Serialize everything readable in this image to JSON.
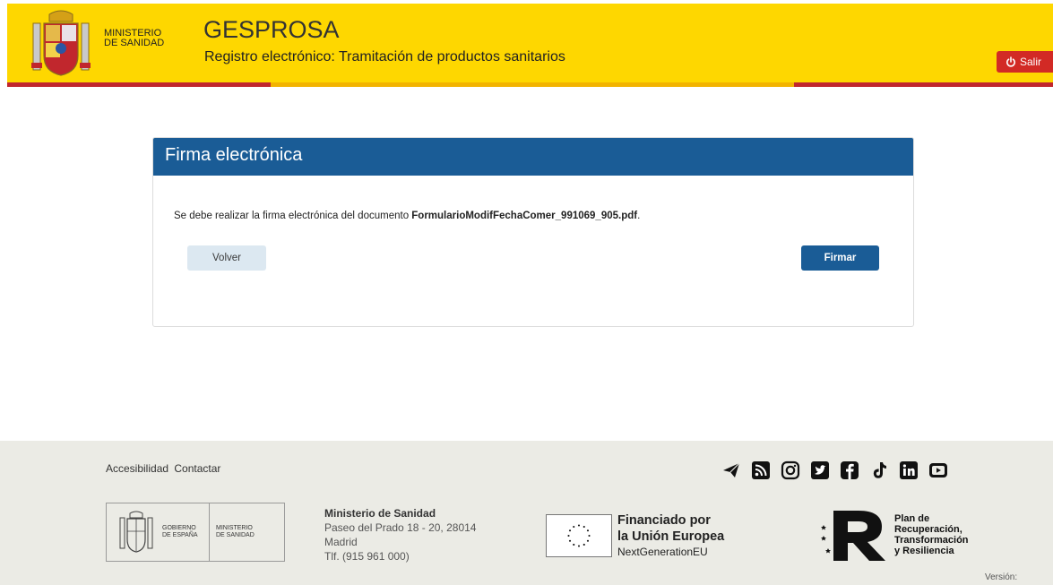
{
  "header": {
    "ministry_line1": "MINISTERIO",
    "ministry_line2": "DE SANIDAD",
    "app_title": "GESPROSA",
    "app_subtitle": "Registro electrónico: Tramitación de productos sanitarios",
    "logout_label": "Salir",
    "logout_icon": "power-icon"
  },
  "panel": {
    "title": "Firma electrónica",
    "message_prefix": "Se debe realizar la firma electrónica del documento ",
    "document_name": "FormularioModifFechaComer_991069_905.pdf",
    "message_suffix": ".",
    "back_label": "Volver",
    "sign_label": "Firmar"
  },
  "footer": {
    "links": [
      "Accesibilidad",
      "Contactar"
    ],
    "social_icons": [
      "telegram-icon",
      "rss-icon",
      "instagram-icon",
      "twitter-icon",
      "facebook-icon",
      "tiktok-icon",
      "linkedin-icon",
      "youtube-icon"
    ],
    "gov_logo": {
      "gobierno_line1": "GOBIERNO",
      "gobierno_line2": "DE ESPAÑA",
      "ministerio_line1": "MINISTERIO",
      "ministerio_line2": "DE SANIDAD"
    },
    "address": {
      "name": "Ministerio de Sanidad",
      "street": "Paseo del Prado 18 - 20, 28014",
      "city": "Madrid",
      "phone": "Tlf. (915 961 000)"
    },
    "eu": {
      "line1": "Financiado por",
      "line2": "la Unión Europea",
      "line3": "NextGenerationEU"
    },
    "prtr": {
      "line1": "Plan de",
      "line2": "Recuperación,",
      "line3": "Transformación",
      "line4": "y Resiliencia"
    },
    "version_label": "Versión:"
  },
  "colors": {
    "header_yellow": "#fed700",
    "stripe_red": "#c1272d",
    "panel_blue": "#1a5c96",
    "logout_red": "#d22a25",
    "footer_bg": "#ebebe5"
  }
}
